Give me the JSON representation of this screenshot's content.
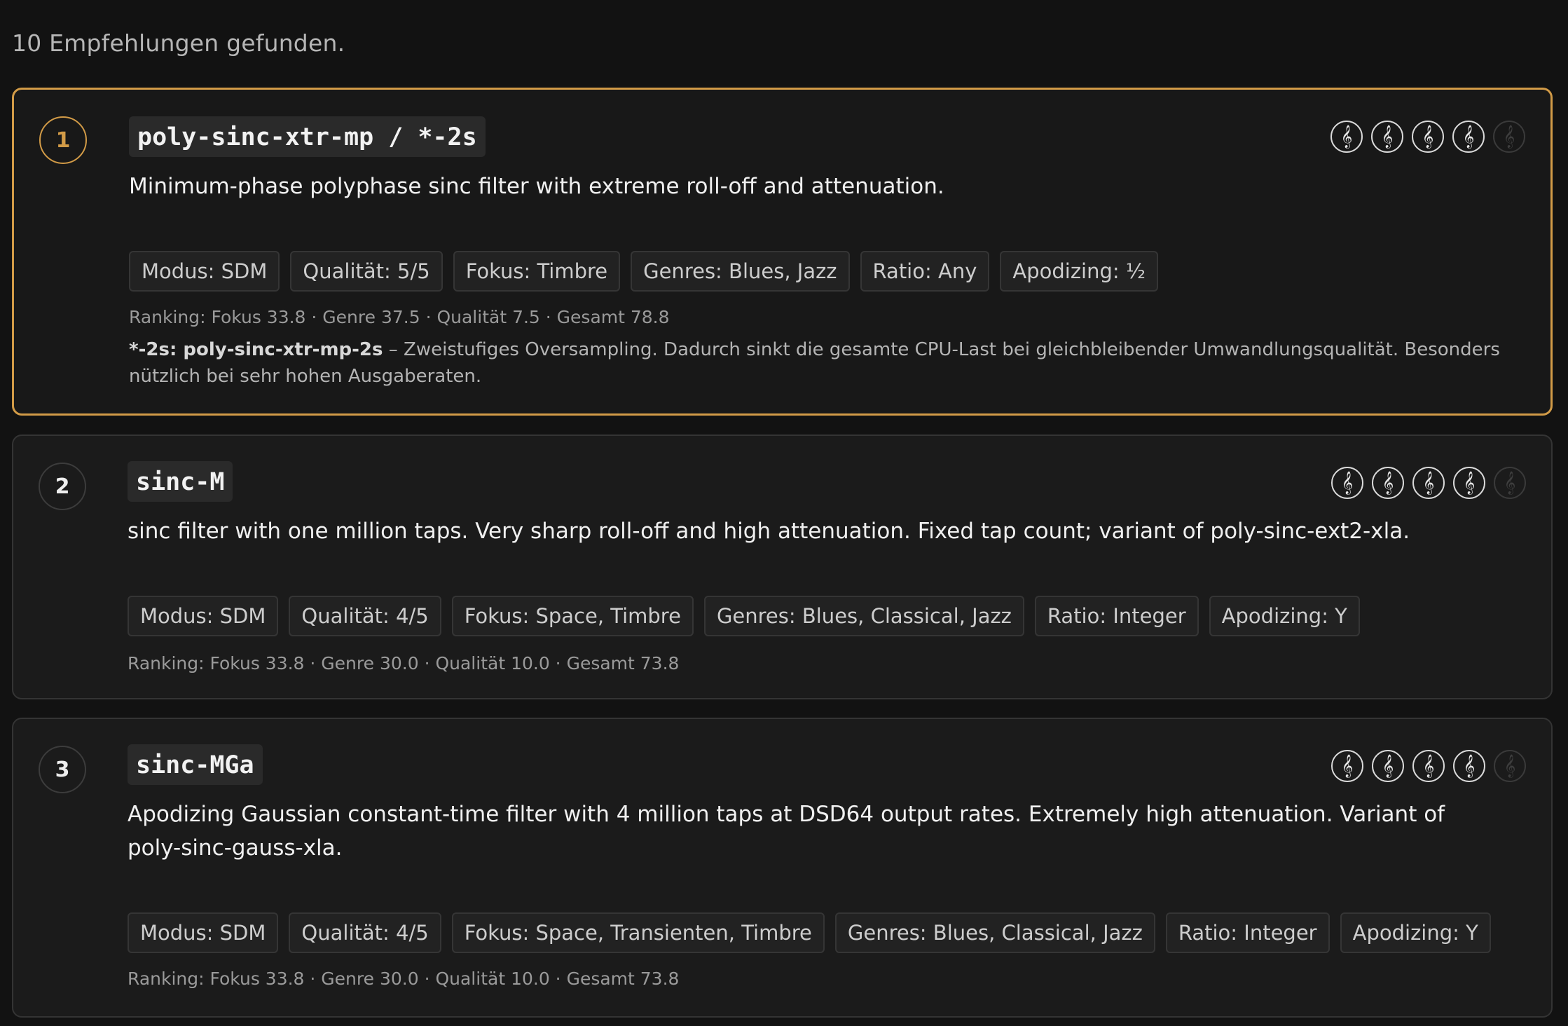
{
  "results_count": "10 Empfehlungen gefunden.",
  "colors": {
    "accent": "#d29b47",
    "background": "#121212",
    "card": "#1b1b1b"
  },
  "rating_icon": "treble-clef-icon",
  "cards": [
    {
      "rank": "1",
      "highlighted": true,
      "name": "poly-sinc-xtr-mp / *-2s",
      "description": "Minimum-phase polyphase sinc filter with extreme roll-off and attenuation.",
      "rating": 4,
      "rating_max": 5,
      "tags": [
        "Modus: SDM",
        "Qualität: 5/5",
        "Fokus: Timbre",
        "Genres: Blues, Jazz",
        "Ratio: Any",
        "Apodizing: ½"
      ],
      "ranking": "Ranking: Fokus 33.8 · Genre 37.5 · Qualität 7.5 · Gesamt 78.8",
      "note_label": "*-2s: poly-sinc-xtr-mp-2s",
      "note_text": " – Zweistufiges Oversampling. Dadurch sinkt die gesamte CPU-Last bei gleichbleibender Umwandlungsqualität. Besonders nützlich bei sehr hohen Ausgaberaten."
    },
    {
      "rank": "2",
      "highlighted": false,
      "name": "sinc-M",
      "description": "sinc filter with one million taps. Very sharp roll-off and high attenuation. Fixed tap count; variant of poly-sinc-ext2-xla.",
      "rating": 4,
      "rating_max": 5,
      "tags": [
        "Modus: SDM",
        "Qualität: 4/5",
        "Fokus: Space, Timbre",
        "Genres: Blues, Classical, Jazz",
        "Ratio: Integer",
        "Apodizing: Y"
      ],
      "ranking": "Ranking: Fokus 33.8 · Genre 30.0 · Qualität 10.0 · Gesamt 73.8"
    },
    {
      "rank": "3",
      "highlighted": false,
      "name": "sinc-MGa",
      "description": "Apodizing Gaussian constant-time filter with 4 million taps at DSD64 output rates. Extremely high attenuation. Variant of poly-sinc-gauss-xla.",
      "rating": 4,
      "rating_max": 5,
      "tags": [
        "Modus: SDM",
        "Qualität: 4/5",
        "Fokus: Space, Transienten, Timbre",
        "Genres: Blues, Classical, Jazz",
        "Ratio: Integer",
        "Apodizing: Y"
      ],
      "ranking": "Ranking: Fokus 33.8 · Genre 30.0 · Qualität 10.0 · Gesamt 73.8"
    }
  ]
}
